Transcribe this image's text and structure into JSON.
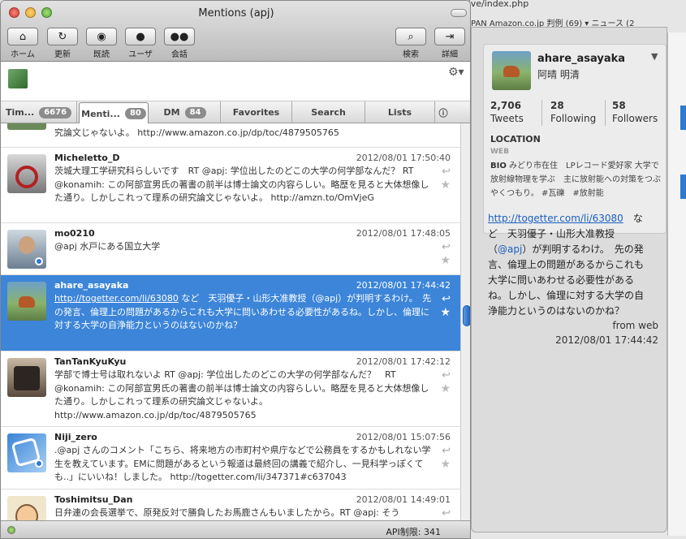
{
  "background": {
    "url": "http://www.cml-office.org/archive/index.php",
    "bookmarks": "PAN   Amazon.co.jp   判例 (69) ▾   ニュース (2"
  },
  "window": {
    "title": "Mentions (apj)",
    "toolbar": {
      "home": "ホーム",
      "refresh": "更新",
      "read": "既読",
      "user": "ユーザ",
      "conversation": "会話",
      "search": "検索",
      "detail": "詳細"
    }
  },
  "tabs": [
    {
      "label": "Tim...",
      "badge": "6676"
    },
    {
      "label": "Menti...",
      "badge": "80"
    },
    {
      "label": "DM",
      "badge": "84"
    },
    {
      "label": "Favorites",
      "badge": ""
    },
    {
      "label": "Search",
      "badge": ""
    },
    {
      "label": "Lists",
      "badge": ""
    }
  ],
  "tweets": [
    {
      "user": "",
      "date": "",
      "text": "究論文じゃないよ。 http://www.amazon.co.jp/dp/toc/4879505765"
    },
    {
      "user": "Micheletto_D",
      "date": "2012/08/01 17:50:40",
      "text": "茨城大理工学研究科らしいです　RT @apj: 学位出したのどこの大学の何学部なんだ？ RT @konamih: この阿部宣男氏の著書の前半は博士論文の内容らしい。略歴を見ると大体想像した通り。しかしこれって理系の研究論文じゃないよ。 http://amzn.to/OmVjeG"
    },
    {
      "user": "mo0210",
      "date": "2012/08/01 17:48:05",
      "text": "@apj 水戸にある国立大学"
    },
    {
      "user": "ahare_asayaka",
      "date": "2012/08/01 17:44:42",
      "link": "http://togetter.com/li/63080",
      "text": " など　天羽優子・山形大准教授（@apj）が判明するわけ。　先の発言、倫理上の問題があるからこれも大学に問いあわせる必要性があるね。しかし、倫理に対する大学の自浄能力というのはないのかね？"
    },
    {
      "user": "TanTanKyuKyu",
      "date": "2012/08/01 17:42:12",
      "text": "学部で博士号は取れないよ RT @apj: 学位出したのどこの大学の何学部なんだ？　RT @konamih: この阿部宣男氏の著書の前半は博士論文の内容らしい。略歴を見ると大体想像した通り。しかしこれって理系の研究論文じゃないよ。 http://www.amazon.co.jp/dp/toc/4879505765"
    },
    {
      "user": "Niji_zero",
      "date": "2012/08/01 15:07:56",
      "text": ".@apj さんのコメント「こちら、将来地方の市町村や県庁などで公務員をするかもしれない学生を教えています。EMに問題があるという報道は最終回の講義で紹介し、一見科学っぽくても..」にいいね！しました。 http://togetter.com/li/347371#c637043"
    },
    {
      "user": "Toshimitsu_Dan",
      "date": "2012/08/01 14:49:01",
      "text": "日弁連の会長選挙で、原発反対で勝負したお馬鹿さんもいましたから。RT @apj: そう"
    }
  ],
  "status": {
    "api": "API制限: 341"
  },
  "detail": {
    "screen_name": "ahare_asayaka",
    "name": "阿晴 明清",
    "tweets_count": "2,706",
    "tweets_label": "Tweets",
    "following_count": "28",
    "following_label": "Following",
    "followers_count": "58",
    "followers_label": "Followers",
    "location_label": "LOCATION",
    "web_label": "WEB",
    "bio_label": "BIO",
    "bio": "みどり市在住　LPレコード愛好家 大学で放射線物理を学ぶ　主に放射能への対策をつぶやくつもり。 #瓦礫　#放射能",
    "tweet_link": "http://togetter.com/li/63080",
    "tweet_rest1": "　など　天羽優子・山形大准教授（",
    "tweet_mention": "@apj",
    "tweet_rest2": "）が判明するわけ。　先の発言、倫理上の問題があるからこれも大学に問いあわせる必要性があるね。しかし、倫理に対する大学の自浄能力というのはないのかね？",
    "from": "from web",
    "date": "2012/08/01 17:44:42"
  }
}
